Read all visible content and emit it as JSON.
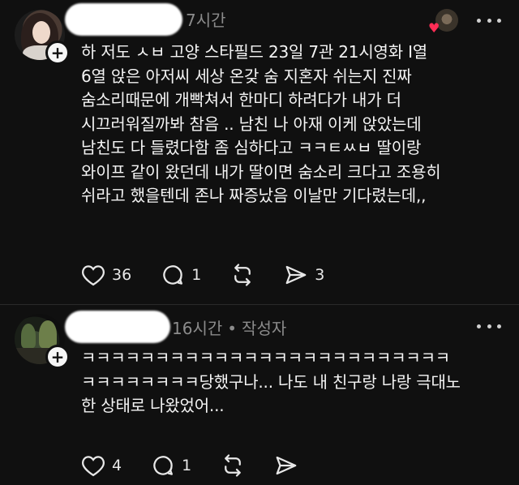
{
  "posts": [
    {
      "meta": {
        "time": "7시간"
      },
      "text": "하 저도 ㅅㅂ 고양 스타필드 23일 7관 21시영화 I열\n6열 앉은 아저씨 세상 온갖 숨 지혼자 쉬는지 진짜\n숨소리때문에 개빡쳐서 한마디 하려다가 내가 더\n시끄러워질까봐 참음 .. 남친 나 아재 이케 앉았는데\n남친도 다 들렸다함 좀 심하다고 ㅋㅋㅌㅆㅂ 딸이랑\n와이프 같이 왔던데 내가 딸이면 숨소리 크다고 조용히\n쉬라고 했을텐데 존나 짜증났음 이날만 기다렸는데,,",
      "actions": {
        "likes": "36",
        "replies": "1",
        "reposts": "",
        "shares": "3"
      }
    },
    {
      "meta": {
        "time": "16시간",
        "badge": "작성자"
      },
      "text": "ㅋㅋㅋㅋㅋㅋㅋㅋㅋㅋㅋㅋㅋㅋㅋㅋㅋㅋㅋㅋㅋㅋㅋㅋㅋ\nㅋㅋㅋㅋㅋㅋㅋㅋ당했구나... 나도 내 친구랑 나랑 극대노\n한 상태로 나왔었어...",
      "actions": {
        "likes": "4",
        "replies": "1",
        "reposts": "",
        "shares": ""
      }
    }
  ],
  "icons": {
    "follow": "plus",
    "more": "ellipsis",
    "like": "heart-outline",
    "reply": "speech-bubble",
    "repost": "repost-arrows",
    "share": "send-arrow",
    "liked_by": "red-heart"
  },
  "colors": {
    "background": "#101010",
    "text": "#f4f4f4",
    "meta": "#8b8b8b",
    "heart": "#ff2d55"
  }
}
